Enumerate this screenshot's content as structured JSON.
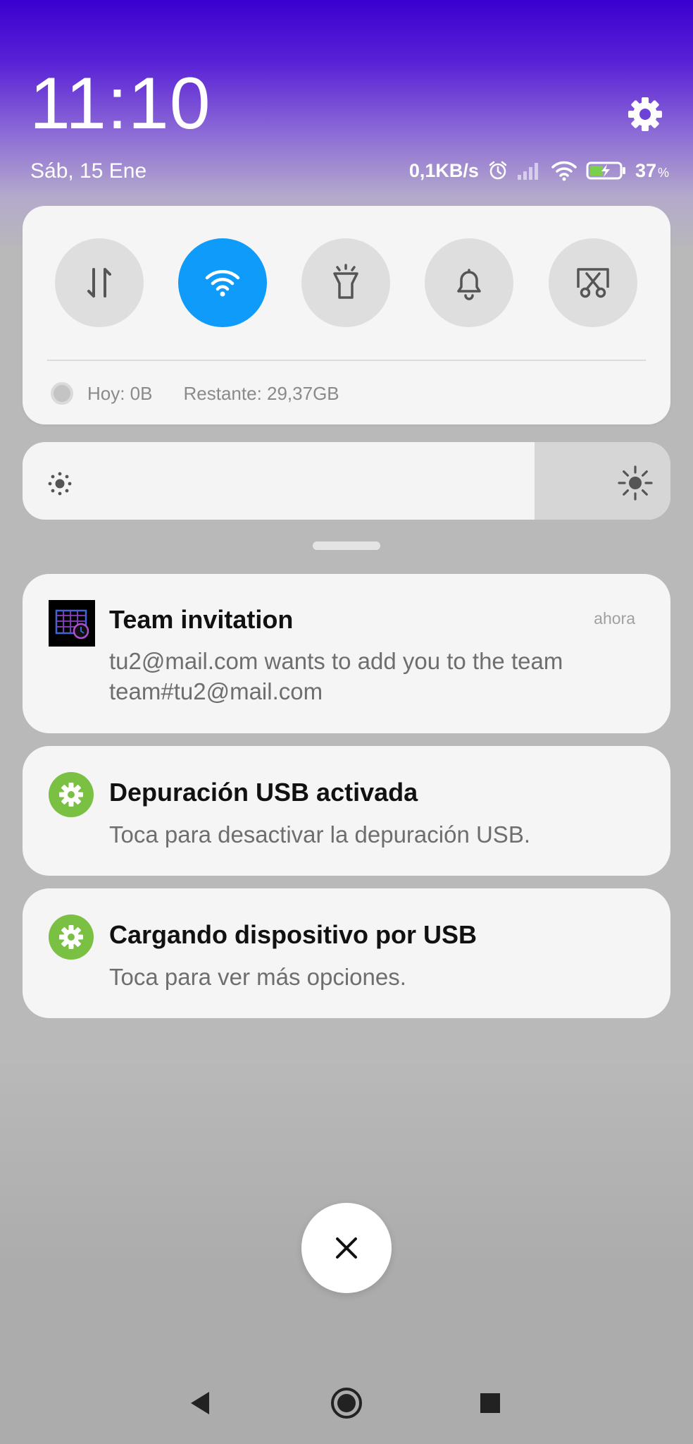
{
  "header": {
    "time": "11:10",
    "date": "Sáb, 15 Ene",
    "settings_icon": "gear-icon"
  },
  "status_bar": {
    "network_speed": "0,1KB/s",
    "battery_percent": "37",
    "battery_unit": "%",
    "icons": [
      "alarm-icon",
      "signal-icon",
      "wifi-icon",
      "battery-charging-icon"
    ]
  },
  "quick_settings": {
    "tiles": [
      {
        "name": "mobile-data",
        "icon": "data-arrows-icon",
        "active": false
      },
      {
        "name": "wifi",
        "icon": "wifi-icon",
        "active": true
      },
      {
        "name": "flashlight",
        "icon": "flashlight-icon",
        "active": false
      },
      {
        "name": "sound",
        "icon": "bell-icon",
        "active": false
      },
      {
        "name": "screenshot",
        "icon": "screenshot-icon",
        "active": false
      }
    ],
    "data_today": "Hoy: 0B",
    "data_remaining": "Restante: 29,37GB"
  },
  "brightness": {
    "level": 0.79,
    "low_icon": "brightness-low-icon",
    "high_icon": "brightness-high-icon"
  },
  "notifications": [
    {
      "title": "Team invitation",
      "time": "ahora",
      "body": "tu2@mail.com wants to add you to the team team#tu2@mail.com",
      "icon": "app-calendar-icon"
    },
    {
      "title": "Depuración USB activada",
      "body": "Toca para desactivar la depuración USB.",
      "icon": "gear-icon"
    },
    {
      "title": "Cargando dispositivo por USB",
      "body": "Toca para ver más opciones.",
      "icon": "gear-icon"
    }
  ],
  "colors": {
    "accent": "#0e9bf9",
    "system_gear": "#7ac043",
    "background_top": "#3a00cf"
  },
  "nav_bar": [
    "back-icon",
    "home-icon",
    "recents-icon"
  ]
}
